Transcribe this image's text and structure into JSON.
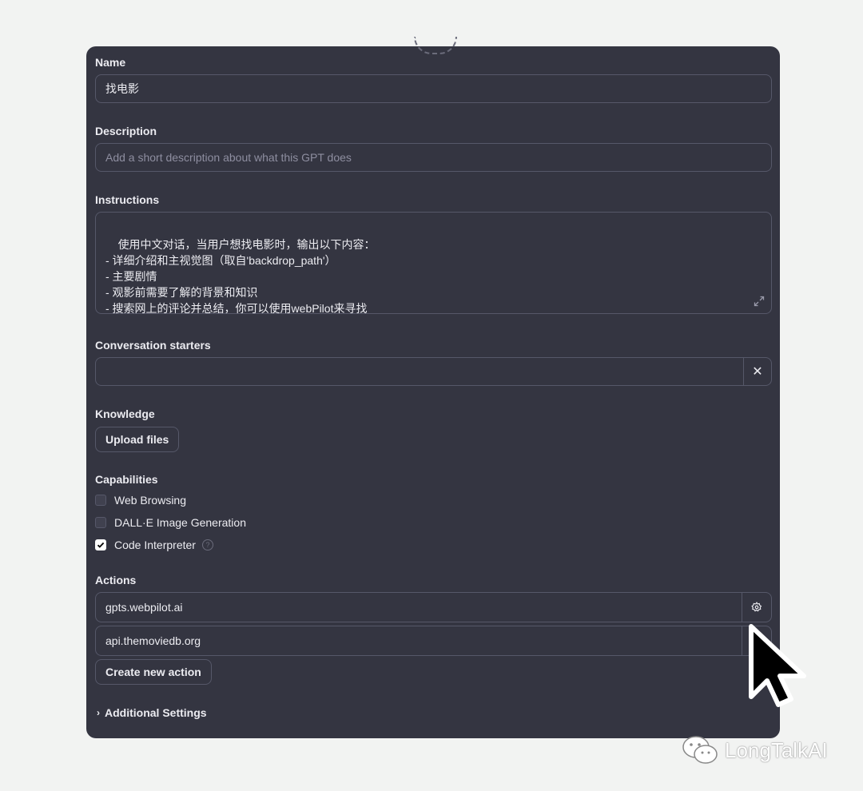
{
  "name": {
    "label": "Name",
    "value": "找电影"
  },
  "description": {
    "label": "Description",
    "placeholder": "Add a short description about what this GPT does",
    "value": ""
  },
  "instructions": {
    "label": "Instructions",
    "value": "使用中文对话，当用户想找电影时，输出以下内容：\n- 详细介绍和主视觉图（取自'backdrop_path'）\n- 主要剧情\n- 观影前需要了解的背景和知识\n- 搜索网上的评论并总结，你可以使用webPilot来寻找"
  },
  "conversation_starters": {
    "label": "Conversation starters",
    "value": "",
    "remove_glyph": "✕"
  },
  "knowledge": {
    "label": "Knowledge",
    "upload_label": "Upload files"
  },
  "capabilities": {
    "label": "Capabilities",
    "items": [
      {
        "label": "Web Browsing",
        "checked": false
      },
      {
        "label": "DALL·E Image Generation",
        "checked": false
      },
      {
        "label": "Code Interpreter",
        "checked": true
      }
    ],
    "help_glyph": "?"
  },
  "actions": {
    "label": "Actions",
    "items": [
      {
        "name": "gpts.webpilot.ai"
      },
      {
        "name": "api.themoviedb.org"
      }
    ],
    "create_label": "Create new action"
  },
  "additional_settings": {
    "label": "Additional Settings",
    "chevron_glyph": "›"
  },
  "watermark": {
    "text": "LongTalkAI"
  },
  "colors": {
    "panel_bg": "#343541",
    "page_bg": "#f2f3f2",
    "border": "#565869",
    "text": "#ececf1",
    "placeholder": "#8e8ea0"
  }
}
